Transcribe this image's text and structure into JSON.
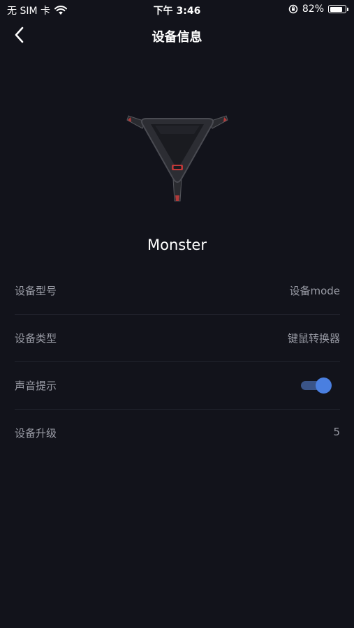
{
  "status_bar": {
    "carrier": "无 SIM 卡",
    "time": "下午 3:46",
    "battery": "82%",
    "battery_level": 0.82
  },
  "nav": {
    "title": "设备信息",
    "back_icon": "chevron-left-icon"
  },
  "device": {
    "name": "Monster",
    "image": "device-triangle-controller"
  },
  "info_rows": [
    {
      "label": "设备型号",
      "value": "设备mode"
    },
    {
      "label": "设备类型",
      "value": "键鼠转换器"
    },
    {
      "label": "声音提示",
      "toggle_on": true
    },
    {
      "label": "设备升级",
      "value": "5"
    }
  ],
  "colors": {
    "background": "#12131b",
    "toggle_knob": "#4a7fe0",
    "toggle_track": "#3a5488"
  }
}
